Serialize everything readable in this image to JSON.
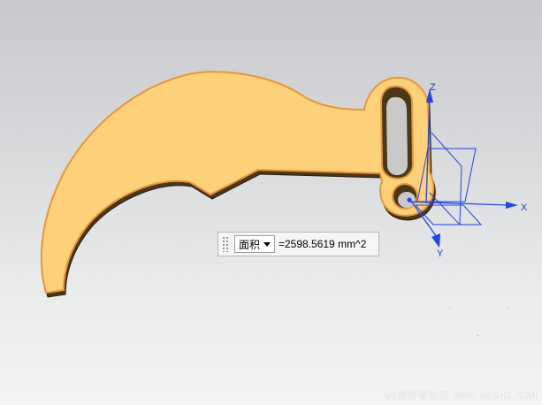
{
  "viewport": {
    "part_fill": "#fdd07a",
    "part_edge": "#e89a3a",
    "part_shadow": "#3a2a14",
    "axis_color": "#2046e6"
  },
  "axes": {
    "x_label": "X",
    "y_label": "Y",
    "z_label": "Z"
  },
  "measure": {
    "type_selected": "面积",
    "value": "=2598.5619 mm^2"
  },
  "watermark": {
    "text": "UG爱好者论坛 WWW.UGSNX.COM"
  }
}
